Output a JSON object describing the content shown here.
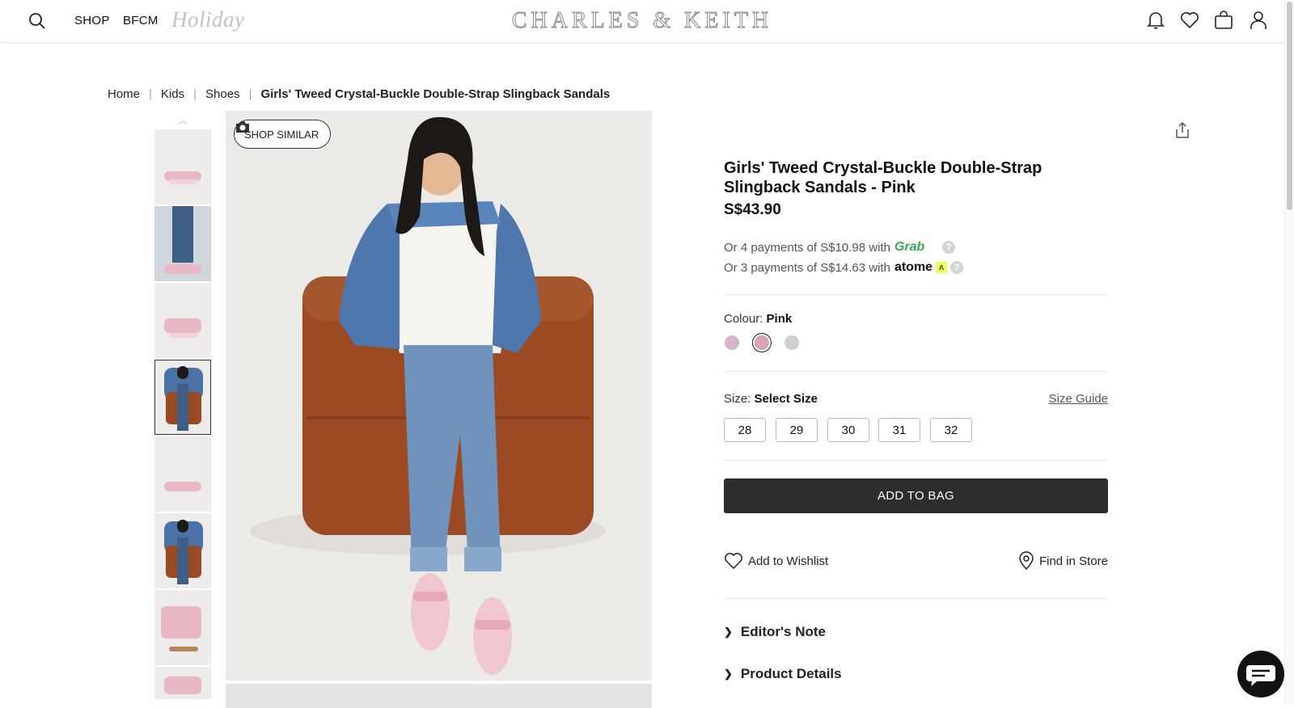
{
  "header": {
    "nav": [
      "SHOP",
      "BFCM"
    ],
    "promo_script": "Holiday",
    "logo": "CHARLES & KEITH",
    "icons": [
      "search-icon",
      "bell-icon",
      "heart-icon",
      "bag-icon",
      "user-icon"
    ]
  },
  "breadcrumb": [
    "Home",
    "Kids",
    "Shoes",
    "Girls' Tweed Crystal-Buckle Double-Strap Slingback Sandals"
  ],
  "gallery": {
    "shop_similar": "SHOP SIMILAR",
    "thumbnail_count": 8,
    "selected_index": 3
  },
  "product": {
    "title": "Girls' Tweed Crystal-Buckle Double-Strap Slingback Sandals - Pink",
    "price": "S$43.90",
    "grab_line": "Or 4 payments of S$10.98 with",
    "grab_brand": "Grab",
    "atome_line": "Or 3 payments of S$14.63 with",
    "atome_brand": "atome",
    "help_mark": "?",
    "colour_label": "Colour:",
    "colour_value": "Pink",
    "colours": [
      "#d8b4c8",
      "#d9a5b5",
      "#cfcfcf"
    ],
    "selected_colour_index": 1,
    "size_label": "Size:",
    "size_value": "Select Size",
    "size_guide": "Size Guide",
    "sizes": [
      "28",
      "29",
      "30",
      "31",
      "32"
    ],
    "add_to_bag": "ADD TO BAG",
    "wishlist": "Add to Wishlist",
    "find_in_store": "Find in Store",
    "accordions": [
      "Editor's Note",
      "Product Details"
    ]
  }
}
